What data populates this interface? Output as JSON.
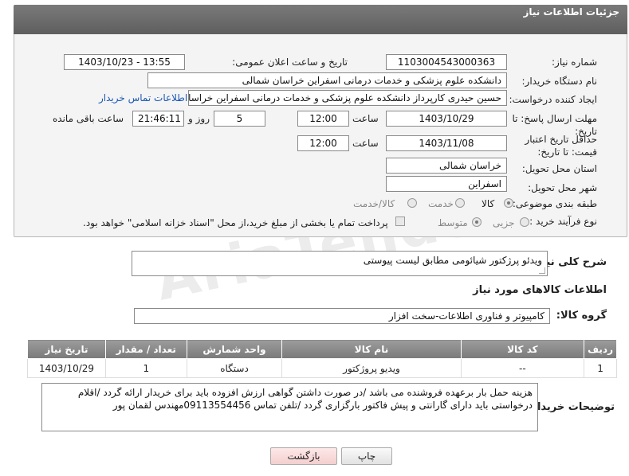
{
  "panel": {
    "title": "جزئیات اطلاعات نیاز"
  },
  "fields": {
    "need_number_label": "شماره نیاز:",
    "need_number": "1103004543000363",
    "announce_label": "تاریخ و ساعت اعلان عمومی:",
    "announce_value": "1403/10/23 - 13:55",
    "buyer_label": "نام دستگاه خریدار:",
    "buyer_value": "دانشکده علوم پزشکی و خدمات درمانی اسفراین خراسان شمالی",
    "requester_label": "ایجاد کننده درخواست:",
    "requester_value": "حسین  حیدری کارپرداز دانشکده علوم پزشکی و خدمات درمانی اسفراین خراسان شمالی",
    "buyer_contact_link": "اطلاعات تماس خریدار",
    "deadline_label": "مهلت ارسال پاسخ: تا تاریخ:",
    "deadline_date": "1403/10/29",
    "time_label": "ساعت",
    "deadline_time": "12:00",
    "days_value": "5",
    "days_label": "روز و",
    "remaining_time": "21:46:11",
    "remaining_label": "ساعت باقی مانده",
    "validity_label": "حداقل تاریخ اعتبار قیمت: تا تاریخ:",
    "validity_date": "1403/11/08",
    "validity_time": "12:00",
    "province_label": "استان محل تحویل:",
    "province_value": "خراسان شمالی",
    "city_label": "شهر محل تحویل:",
    "city_value": "اسفراین",
    "category_label": "طبقه بندی موضوعی:",
    "category_options": [
      "کالا",
      "خدمت",
      "کالا/خدمت"
    ],
    "process_label": "نوع فرآیند خرید :",
    "process_options": [
      "جزیی",
      "متوسط"
    ],
    "payment_note": "پرداخت تمام یا بخشی از مبلغ خرید،از محل \"اسناد خزانه اسلامی\" خواهد بود."
  },
  "general_desc": {
    "label": "شرح کلی نیاز:",
    "value": "ویدئو پرژکتور شیائومی مطابق لیست پیوستی"
  },
  "goods_info": {
    "title": "اطلاعات کالاهای مورد نیاز",
    "group_label": "گروه کالا:",
    "group_value": "کامپیوتر و فناوری اطلاعات-سخت افزار"
  },
  "table": {
    "headers": [
      "ردیف",
      "کد کالا",
      "نام کالا",
      "واحد شمارش",
      "تعداد / مقدار",
      "تاریخ نیاز"
    ],
    "rows": [
      [
        "1",
        "--",
        "ویدیو پروژکتور",
        "دستگاه",
        "1",
        "1403/10/29"
      ]
    ]
  },
  "buyer_notes": {
    "label": "توضیحات خریدار:",
    "value": "هزینه حمل بار برعهده فروشنده می باشد /در صورت داشتن گواهی ارزش افزوده باید برای خریدار ارائه گردد /اقلام درخواستی باید دارای گارانتی و پیش فاکتور بارگزاری گردد /تلفن تماس 09113554456مهندس لقمان پور"
  },
  "buttons": {
    "print": "چاپ",
    "back": "بازگشت"
  },
  "watermark": "AriaTender.net"
}
